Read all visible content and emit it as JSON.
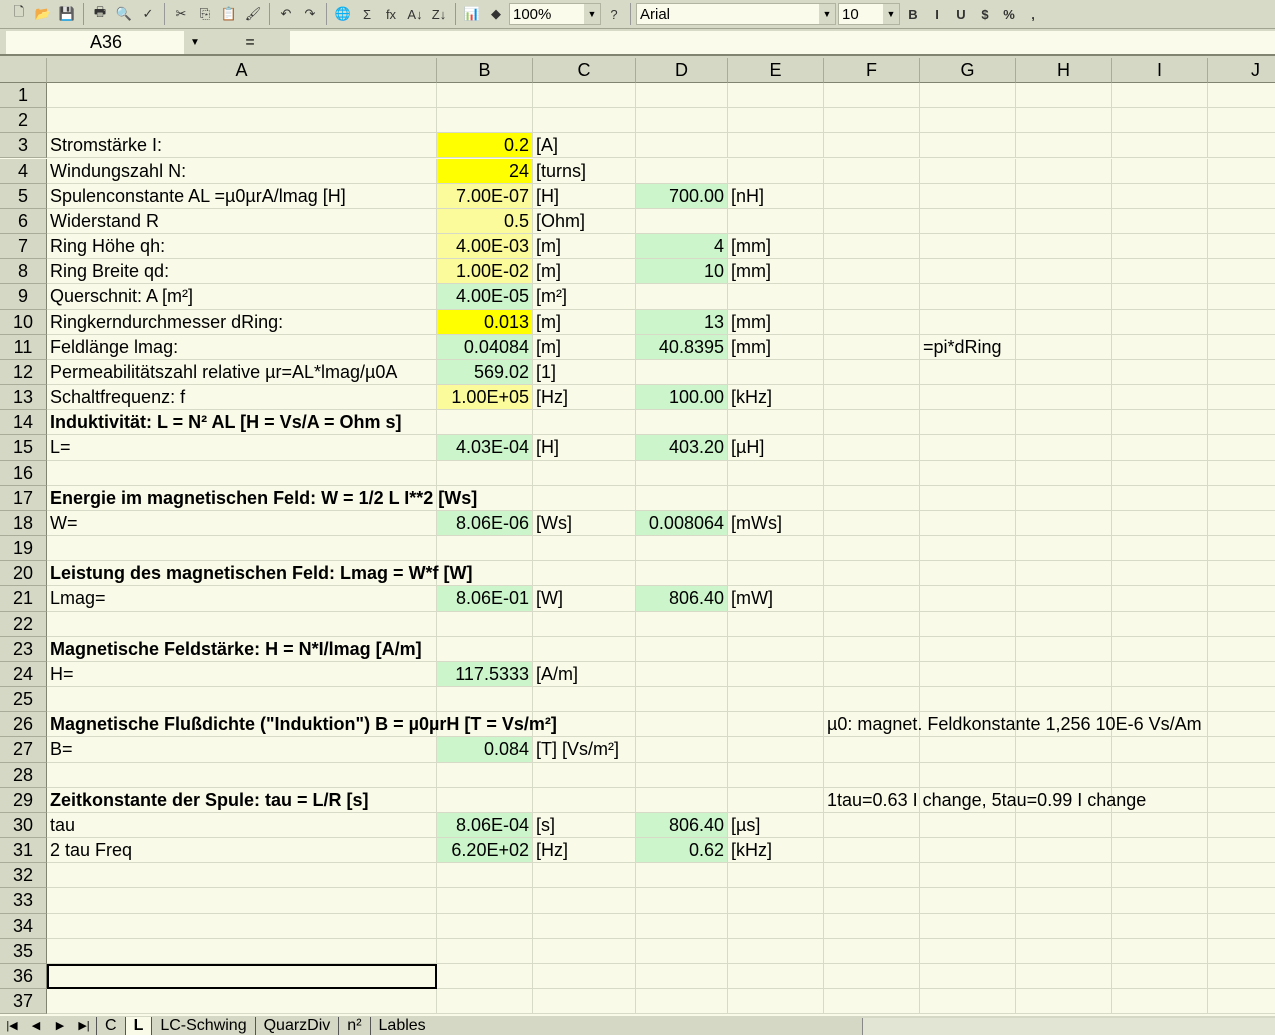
{
  "toolbar": {
    "zoom": "100%",
    "font": "Arial",
    "size": "10",
    "icons": [
      "new-icon",
      "open-icon",
      "save-icon",
      "print-icon",
      "preview-icon",
      "spell-icon",
      "cut-icon",
      "copy-icon",
      "paste-icon",
      "format-painter-icon",
      "undo-icon",
      "redo-icon",
      "hyperlink-icon",
      "autosum-icon",
      "function-icon",
      "sort-asc-icon",
      "sort-desc-icon",
      "chart-icon",
      "drawing-icon"
    ],
    "format_buttons": [
      "B",
      "I",
      "U",
      "$",
      "%",
      ","
    ]
  },
  "formula_bar": {
    "name_box": "A36",
    "equals": "=",
    "content": ""
  },
  "columns": [
    "A",
    "B",
    "C",
    "D",
    "E",
    "F",
    "G",
    "H",
    "I",
    "J"
  ],
  "colors": {
    "yellow": "#ffff00",
    "light_yellow": "#fbfb9c",
    "green": "#ccf5cc",
    "background": "#fafae8"
  },
  "rows": [
    {
      "n": "1"
    },
    {
      "n": "2"
    },
    {
      "n": "3",
      "A": "Stromstärke I:",
      "B": "0.2",
      "Bf": "y",
      "C": "[A]"
    },
    {
      "n": "4",
      "A": "Windungszahl N:",
      "B": "24",
      "Bf": "y",
      "C": "[turns]"
    },
    {
      "n": "5",
      "A": "Spulenconstante AL =µ0µrA/lmag [H]",
      "B": "7.00E-07",
      "Bf": "ly",
      "C": "[H]",
      "D": "700.00",
      "Df": "g",
      "E": "[nH]"
    },
    {
      "n": "6",
      "A": "Widerstand R",
      "B": "0.5",
      "Bf": "ly",
      "C": "[Ohm]"
    },
    {
      "n": "7",
      "A": "Ring Höhe qh:",
      "B": "4.00E-03",
      "Bf": "ly",
      "C": "[m]",
      "D": "4",
      "Df": "g",
      "E": "[mm]"
    },
    {
      "n": "8",
      "A": "Ring Breite qd:",
      "B": "1.00E-02",
      "Bf": "ly",
      "C": "[m]",
      "D": "10",
      "Df": "g",
      "E": "[mm]"
    },
    {
      "n": "9",
      "A": "Querschnit: A [m²]",
      "B": "4.00E-05",
      "Bf": "g",
      "C": "[m²]"
    },
    {
      "n": "10",
      "A": "Ringkerndurchmesser dRing:",
      "B": "0.013",
      "Bf": "y",
      "C": "[m]",
      "D": "13",
      "Df": "g",
      "E": "[mm]"
    },
    {
      "n": "11",
      "A": "Feldlänge lmag:",
      "B": "0.04084",
      "Bf": "g",
      "C": "[m]",
      "D": "40.8395",
      "Df": "g",
      "E": "[mm]",
      "G": "=pi*dRing"
    },
    {
      "n": "12",
      "A": "Permeabilitätszahl relative  µr=AL*lmag/µ0A",
      "B": "569.02",
      "Bf": "g",
      "C": "[1]"
    },
    {
      "n": "13",
      "A": "Schaltfrequenz: f",
      "B": "1.00E+05",
      "Bf": "ly",
      "C": "[Hz]",
      "D": "100.00",
      "Df": "g",
      "E": "[kHz]"
    },
    {
      "n": "14",
      "A": "Induktivität: L = N² AL [H = Vs/A = Ohm s]",
      "bold": true
    },
    {
      "n": "15",
      "A": "L=",
      "B": "4.03E-04",
      "Bf": "g",
      "C": "[H]",
      "D": "403.20",
      "Df": "g",
      "E": "[µH]"
    },
    {
      "n": "16"
    },
    {
      "n": "17",
      "A": "Energie im magnetischen Feld: W = 1/2 L I**2 [Ws]",
      "bold": true
    },
    {
      "n": "18",
      "A": "W=",
      "B": "8.06E-06",
      "Bf": "g",
      "C": "[Ws]",
      "D": "0.008064",
      "Df": "g",
      "E": "[mWs]"
    },
    {
      "n": "19"
    },
    {
      "n": "20",
      "A": "Leistung des magnetischen Feld: Lmag = W*f [W]",
      "bold": true
    },
    {
      "n": "21",
      "A": "Lmag=",
      "B": "8.06E-01",
      "Bf": "g",
      "C": "[W]",
      "D": "806.40",
      "Df": "g",
      "E": "[mW]"
    },
    {
      "n": "22"
    },
    {
      "n": "23",
      "A": "Magnetische Feldstärke: H = N*I/lmag [A/m]",
      "bold": true
    },
    {
      "n": "24",
      "A": "H=",
      "B": "117.5333",
      "Bf": "g",
      "C": "[A/m]"
    },
    {
      "n": "25"
    },
    {
      "n": "26",
      "A": "Magnetische Flußdichte (\"Induktion\") B = µ0µrH [T = Vs/m²]",
      "bold": true,
      "F": "µ0: magnet. Feldkonstante 1,256 10E-6 Vs/Am"
    },
    {
      "n": "27",
      "A": "B=",
      "B": "0.084",
      "Bf": "g",
      "C": "[T] [Vs/m²]"
    },
    {
      "n": "28"
    },
    {
      "n": "29",
      "A": "Zeitkonstante der Spule: tau = L/R [s]",
      "bold": true,
      "F": "1tau=0.63 I change, 5tau=0.99 I change"
    },
    {
      "n": "30",
      "A": "tau",
      "B": "8.06E-04",
      "Bf": "g",
      "C": "[s]",
      "D": "806.40",
      "Df": "g",
      "E": "[µs]"
    },
    {
      "n": "31",
      "A": "2 tau Freq",
      "B": "6.20E+02",
      "Bf": "g",
      "C": "[Hz]",
      "D": "0.62",
      "Df": "g",
      "E": "[kHz]"
    },
    {
      "n": "32"
    },
    {
      "n": "33"
    },
    {
      "n": "34"
    },
    {
      "n": "35"
    },
    {
      "n": "36",
      "selected": "A"
    },
    {
      "n": "37"
    }
  ],
  "sheet_tabs": [
    {
      "label": "C"
    },
    {
      "label": "L",
      "active": true
    },
    {
      "label": "LC-Schwing"
    },
    {
      "label": "QuarzDiv"
    },
    {
      "label": "n²"
    },
    {
      "label": "Lables"
    }
  ]
}
